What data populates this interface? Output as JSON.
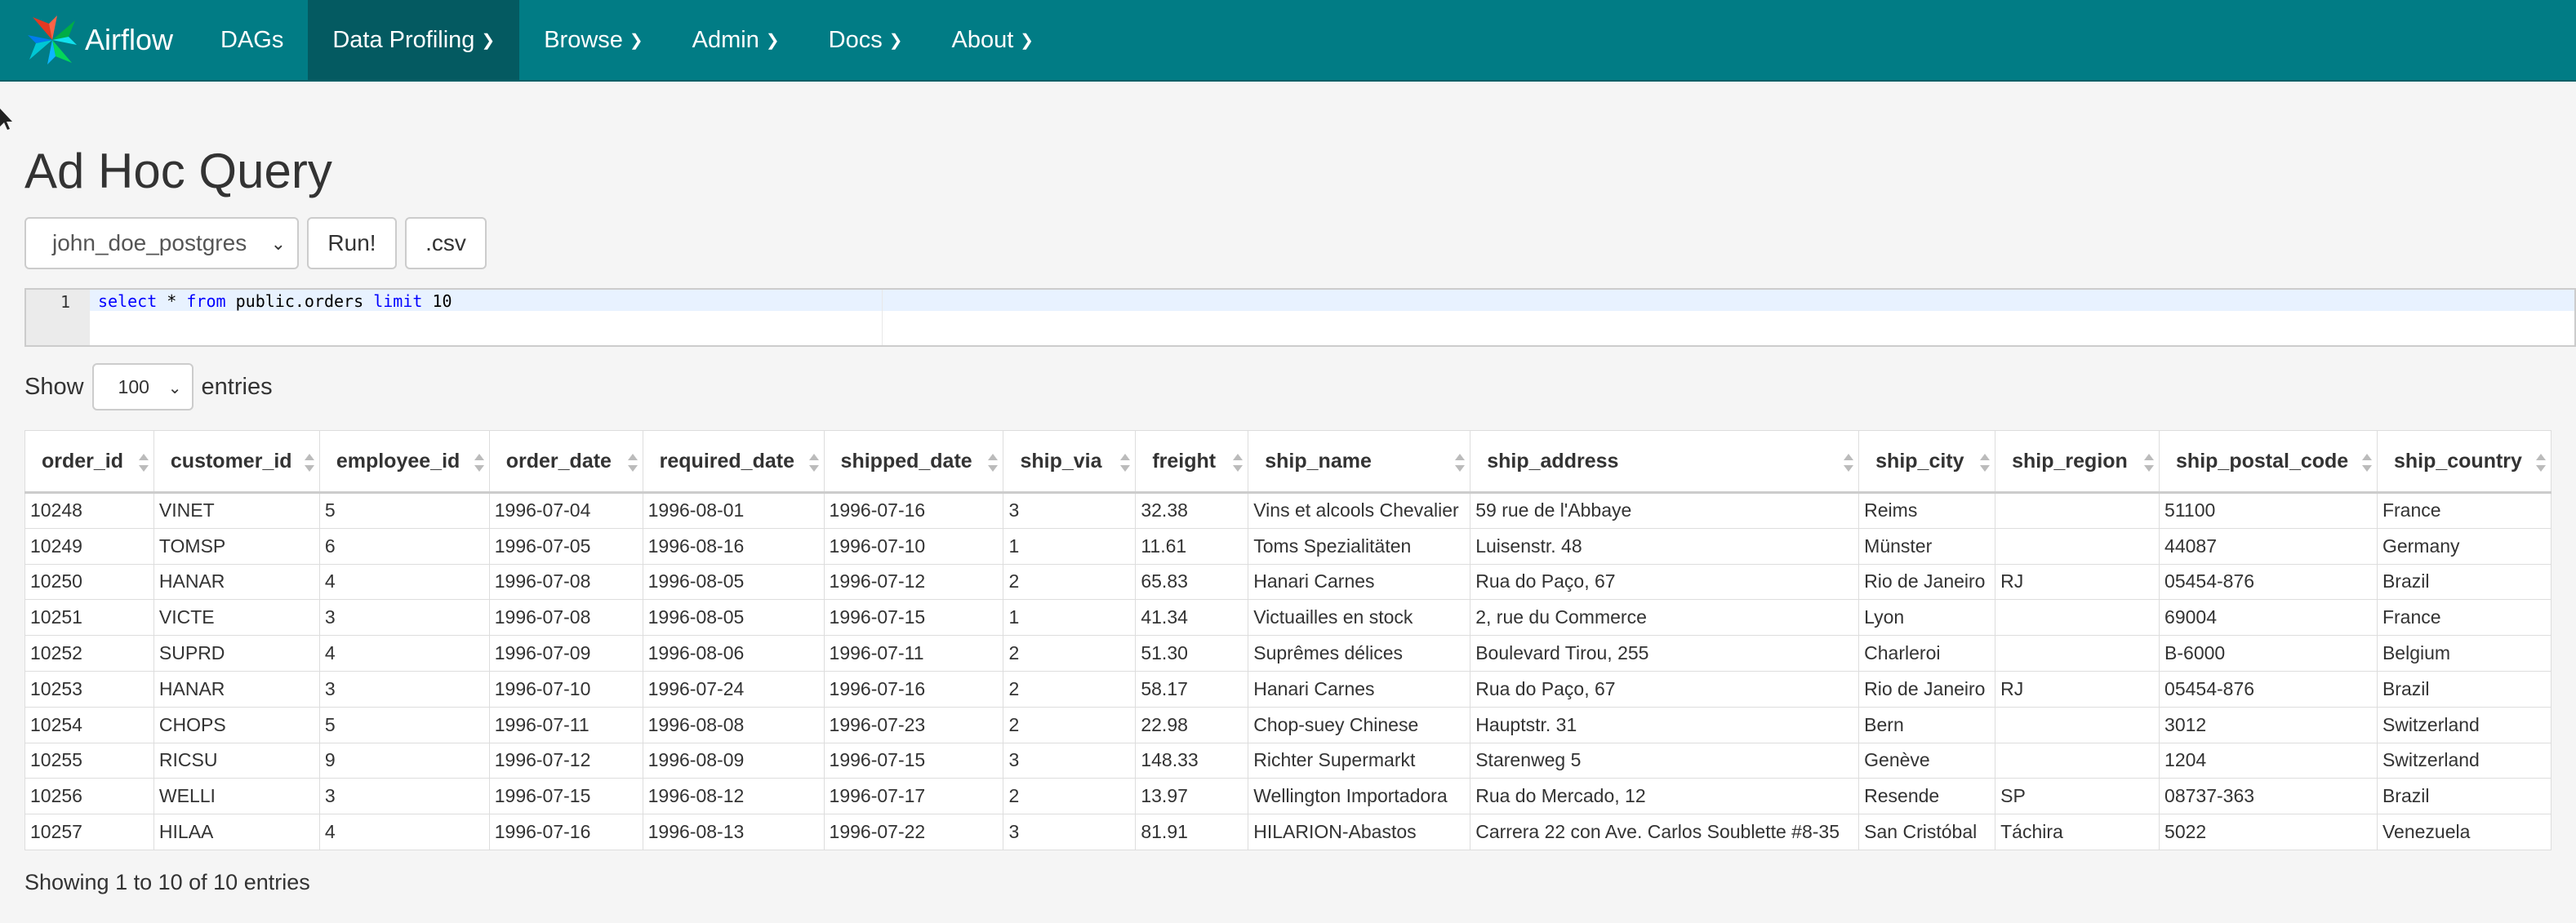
{
  "navbar": {
    "brand": "Airflow",
    "items": [
      {
        "label": "DAGs",
        "dropdown": false
      },
      {
        "label": "Data Profiling",
        "dropdown": true,
        "active": true
      },
      {
        "label": "Browse",
        "dropdown": true
      },
      {
        "label": "Admin",
        "dropdown": true
      },
      {
        "label": "Docs",
        "dropdown": true
      },
      {
        "label": "About",
        "dropdown": true
      }
    ],
    "colors": {
      "background": "#017c85",
      "active": "#045a61"
    }
  },
  "page": {
    "title": "Ad Hoc Query",
    "connection_select": "john_doe_postgres",
    "run_button": "Run!",
    "csv_button": ".csv"
  },
  "editor": {
    "line_number": "1",
    "query": "select * from public.orders limit 10"
  },
  "length_menu": {
    "show_label": "Show",
    "value": "100",
    "entries_label": "entries"
  },
  "table": {
    "columns": [
      "order_id",
      "customer_id",
      "employee_id",
      "order_date",
      "required_date",
      "shipped_date",
      "ship_via",
      "freight",
      "ship_name",
      "ship_address",
      "ship_city",
      "ship_region",
      "ship_postal_code",
      "ship_country"
    ],
    "rows": [
      [
        "10248",
        "VINET",
        "5",
        "1996-07-04",
        "1996-08-01",
        "1996-07-16",
        "3",
        "32.38",
        "Vins et alcools Chevalier",
        "59 rue de l'Abbaye",
        "Reims",
        "",
        "51100",
        "France"
      ],
      [
        "10249",
        "TOMSP",
        "6",
        "1996-07-05",
        "1996-08-16",
        "1996-07-10",
        "1",
        "11.61",
        "Toms Spezialitäten",
        "Luisenstr. 48",
        "Münster",
        "",
        "44087",
        "Germany"
      ],
      [
        "10250",
        "HANAR",
        "4",
        "1996-07-08",
        "1996-08-05",
        "1996-07-12",
        "2",
        "65.83",
        "Hanari Carnes",
        "Rua do Paço, 67",
        "Rio de Janeiro",
        "RJ",
        "05454-876",
        "Brazil"
      ],
      [
        "10251",
        "VICTE",
        "3",
        "1996-07-08",
        "1996-08-05",
        "1996-07-15",
        "1",
        "41.34",
        "Victuailles en stock",
        "2, rue du Commerce",
        "Lyon",
        "",
        "69004",
        "France"
      ],
      [
        "10252",
        "SUPRD",
        "4",
        "1996-07-09",
        "1996-08-06",
        "1996-07-11",
        "2",
        "51.30",
        "Suprêmes délices",
        "Boulevard Tirou, 255",
        "Charleroi",
        "",
        "B-6000",
        "Belgium"
      ],
      [
        "10253",
        "HANAR",
        "3",
        "1996-07-10",
        "1996-07-24",
        "1996-07-16",
        "2",
        "58.17",
        "Hanari Carnes",
        "Rua do Paço, 67",
        "Rio de Janeiro",
        "RJ",
        "05454-876",
        "Brazil"
      ],
      [
        "10254",
        "CHOPS",
        "5",
        "1996-07-11",
        "1996-08-08",
        "1996-07-23",
        "2",
        "22.98",
        "Chop-suey Chinese",
        "Hauptstr. 31",
        "Bern",
        "",
        "3012",
        "Switzerland"
      ],
      [
        "10255",
        "RICSU",
        "9",
        "1996-07-12",
        "1996-08-09",
        "1996-07-15",
        "3",
        "148.33",
        "Richter Supermarkt",
        "Starenweg 5",
        "Genève",
        "",
        "1204",
        "Switzerland"
      ],
      [
        "10256",
        "WELLI",
        "3",
        "1996-07-15",
        "1996-08-12",
        "1996-07-17",
        "2",
        "13.97",
        "Wellington Importadora",
        "Rua do Mercado, 12",
        "Resende",
        "SP",
        "08737-363",
        "Brazil"
      ],
      [
        "10257",
        "HILAA",
        "4",
        "1996-07-16",
        "1996-08-13",
        "1996-07-22",
        "3",
        "81.91",
        "HILARION-Abastos",
        "Carrera 22 con Ave. Carlos Soublette #8-35",
        "San Cristóbal",
        "Táchira",
        "5022",
        "Venezuela"
      ]
    ]
  },
  "info": "Showing 1 to 10 of 10 entries"
}
